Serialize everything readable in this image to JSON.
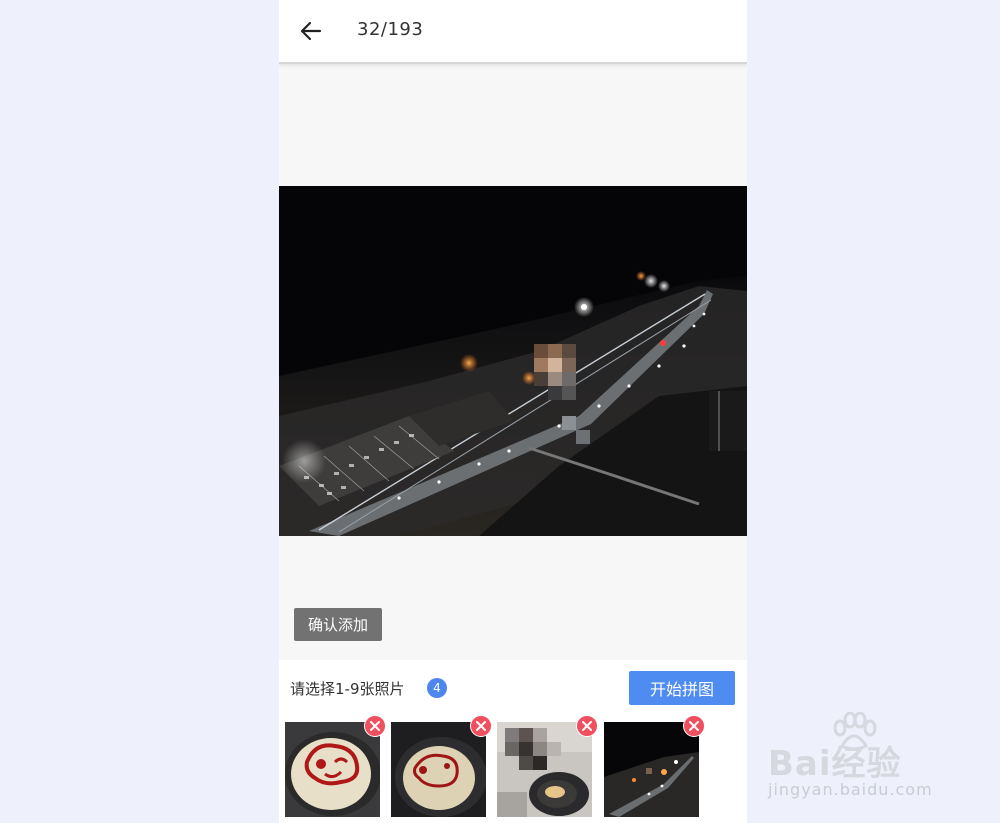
{
  "header": {
    "counter": "32/193"
  },
  "actions": {
    "confirm_label": "确认添加",
    "start_label": "开始拼图"
  },
  "selection": {
    "hint": "请选择1-9张照片",
    "count": "4"
  },
  "thumbnails": [
    {
      "name": "pancake-ketchup-photo-1"
    },
    {
      "name": "pancake-ketchup-photo-2"
    },
    {
      "name": "pan-photo-blurred"
    },
    {
      "name": "night-city-photo"
    }
  ],
  "watermark": {
    "brand": "Bai经验",
    "url": "jingyan.baidu.com"
  },
  "colors": {
    "accent": "#4f8cf2",
    "remove": "#ef4f5e",
    "confirm_bg": "#727272"
  }
}
